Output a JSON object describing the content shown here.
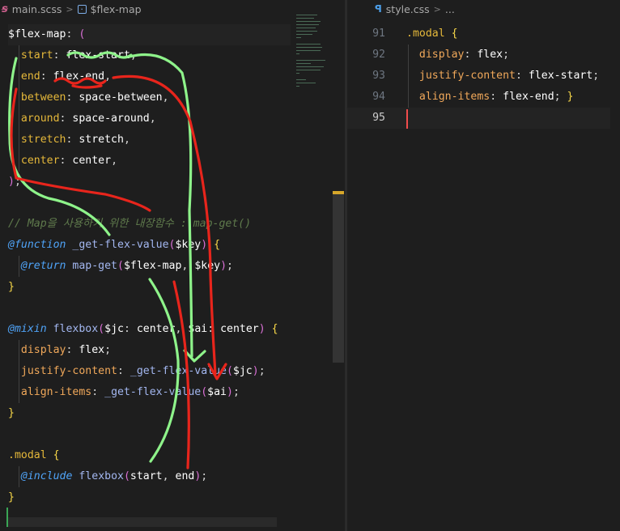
{
  "left_editor": {
    "breadcrumb": {
      "file": "main.scss",
      "symbol": "$flex-map"
    },
    "lines": [
      [
        [
          "tk-var",
          "$flex-map"
        ],
        [
          "tk-punc",
          ": "
        ],
        [
          "tk-paren",
          "("
        ]
      ],
      [
        [
          "tk-punc",
          "  "
        ],
        [
          "tk-key",
          "start"
        ],
        [
          "tk-punc",
          ": "
        ],
        [
          "tk-val",
          "flex-start"
        ],
        [
          "tk-punc",
          ","
        ]
      ],
      [
        [
          "tk-punc",
          "  "
        ],
        [
          "tk-key",
          "end"
        ],
        [
          "tk-punc",
          ": "
        ],
        [
          "tk-val",
          "flex-end"
        ],
        [
          "tk-punc",
          ","
        ]
      ],
      [
        [
          "tk-punc",
          "  "
        ],
        [
          "tk-key",
          "between"
        ],
        [
          "tk-punc",
          ": "
        ],
        [
          "tk-val",
          "space-between"
        ],
        [
          "tk-punc",
          ","
        ]
      ],
      [
        [
          "tk-punc",
          "  "
        ],
        [
          "tk-key",
          "around"
        ],
        [
          "tk-punc",
          ": "
        ],
        [
          "tk-val",
          "space-around"
        ],
        [
          "tk-punc",
          ","
        ]
      ],
      [
        [
          "tk-punc",
          "  "
        ],
        [
          "tk-key",
          "stretch"
        ],
        [
          "tk-punc",
          ": "
        ],
        [
          "tk-val",
          "stretch"
        ],
        [
          "tk-punc",
          ","
        ]
      ],
      [
        [
          "tk-punc",
          "  "
        ],
        [
          "tk-key",
          "center"
        ],
        [
          "tk-punc",
          ": "
        ],
        [
          "tk-val",
          "center"
        ],
        [
          "tk-punc",
          ","
        ]
      ],
      [
        [
          "tk-paren",
          ")"
        ],
        [
          "tk-punc",
          ";"
        ]
      ],
      [],
      [
        [
          "tk-com",
          "// Map을 사용하기 위한 내장함수 : map-get()"
        ]
      ],
      [
        [
          "tk-kw",
          "@function"
        ],
        [
          "tk-punc",
          " "
        ],
        [
          "tk-fn",
          "_get-flex-value"
        ],
        [
          "tk-paren",
          "("
        ],
        [
          "tk-var",
          "$key"
        ],
        [
          "tk-paren",
          ")"
        ],
        [
          "tk-punc",
          " "
        ],
        [
          "tk-brace",
          "{"
        ]
      ],
      [
        [
          "tk-punc",
          "  "
        ],
        [
          "tk-kw",
          "@return"
        ],
        [
          "tk-punc",
          " "
        ],
        [
          "tk-fn",
          "map-get"
        ],
        [
          "tk-paren",
          "("
        ],
        [
          "tk-var",
          "$flex-map"
        ],
        [
          "tk-punc",
          ", "
        ],
        [
          "tk-var",
          "$key"
        ],
        [
          "tk-paren",
          ")"
        ],
        [
          "tk-punc",
          ";"
        ]
      ],
      [
        [
          "tk-brace",
          "}"
        ]
      ],
      [],
      [
        [
          "tk-kw",
          "@mixin"
        ],
        [
          "tk-punc",
          " "
        ],
        [
          "tk-fn",
          "flexbox"
        ],
        [
          "tk-paren",
          "("
        ],
        [
          "tk-var",
          "$jc"
        ],
        [
          "tk-punc",
          ": "
        ],
        [
          "tk-val",
          "center"
        ],
        [
          "tk-punc",
          ", "
        ],
        [
          "tk-var",
          "$ai"
        ],
        [
          "tk-punc",
          ": "
        ],
        [
          "tk-val",
          "center"
        ],
        [
          "tk-paren",
          ")"
        ],
        [
          "tk-punc",
          " "
        ],
        [
          "tk-brace",
          "{"
        ]
      ],
      [
        [
          "tk-punc",
          "  "
        ],
        [
          "tk-prop",
          "display"
        ],
        [
          "tk-punc",
          ": "
        ],
        [
          "tk-val",
          "flex"
        ],
        [
          "tk-punc",
          ";"
        ]
      ],
      [
        [
          "tk-punc",
          "  "
        ],
        [
          "tk-prop",
          "justify-content"
        ],
        [
          "tk-punc",
          ": "
        ],
        [
          "tk-fn",
          "_get-flex-value"
        ],
        [
          "tk-paren",
          "("
        ],
        [
          "tk-var",
          "$jc"
        ],
        [
          "tk-paren",
          ")"
        ],
        [
          "tk-punc",
          ";"
        ]
      ],
      [
        [
          "tk-punc",
          "  "
        ],
        [
          "tk-prop",
          "align-items"
        ],
        [
          "tk-punc",
          ": "
        ],
        [
          "tk-fn",
          "_get-flex-value"
        ],
        [
          "tk-paren",
          "("
        ],
        [
          "tk-var",
          "$ai"
        ],
        [
          "tk-paren",
          ")"
        ],
        [
          "tk-punc",
          ";"
        ]
      ],
      [
        [
          "tk-brace",
          "}"
        ]
      ],
      [],
      [
        [
          "tk-sel",
          ".modal"
        ],
        [
          "tk-punc",
          " "
        ],
        [
          "tk-brace",
          "{"
        ]
      ],
      [
        [
          "tk-punc",
          "  "
        ],
        [
          "tk-kw",
          "@include"
        ],
        [
          "tk-punc",
          " "
        ],
        [
          "tk-fn",
          "flexbox"
        ],
        [
          "tk-paren",
          "("
        ],
        [
          "tk-val",
          "start"
        ],
        [
          "tk-punc",
          ", "
        ],
        [
          "tk-val",
          "end"
        ],
        [
          "tk-paren",
          ")"
        ],
        [
          "tk-punc",
          ";"
        ]
      ],
      [
        [
          "tk-brace",
          "}"
        ]
      ],
      []
    ]
  },
  "right_editor": {
    "breadcrumb": {
      "file": "style.css",
      "symbol": "..."
    },
    "lines": [
      {
        "num": "91",
        "tokens": [
          [
            "tk-sel",
            ".modal"
          ],
          [
            "tk-punc",
            " "
          ],
          [
            "tk-brace",
            "{"
          ]
        ]
      },
      {
        "num": "92",
        "tokens": [
          [
            "tk-punc",
            "  "
          ],
          [
            "tk-prop",
            "display"
          ],
          [
            "tk-punc",
            ": "
          ],
          [
            "tk-val",
            "flex"
          ],
          [
            "tk-punc",
            ";"
          ]
        ]
      },
      {
        "num": "93",
        "tokens": [
          [
            "tk-punc",
            "  "
          ],
          [
            "tk-prop",
            "justify-content"
          ],
          [
            "tk-punc",
            ": "
          ],
          [
            "tk-val",
            "flex-start"
          ],
          [
            "tk-punc",
            ";"
          ]
        ]
      },
      {
        "num": "94",
        "tokens": [
          [
            "tk-punc",
            "  "
          ],
          [
            "tk-prop",
            "align-items"
          ],
          [
            "tk-punc",
            ": "
          ],
          [
            "tk-val",
            "flex-end"
          ],
          [
            "tk-punc",
            "; "
          ],
          [
            "tk-brace",
            "}"
          ]
        ]
      },
      {
        "num": "95",
        "tokens": []
      }
    ]
  },
  "colors": {
    "annotation_green": "#8ef38a",
    "annotation_red": "#e8251c"
  }
}
